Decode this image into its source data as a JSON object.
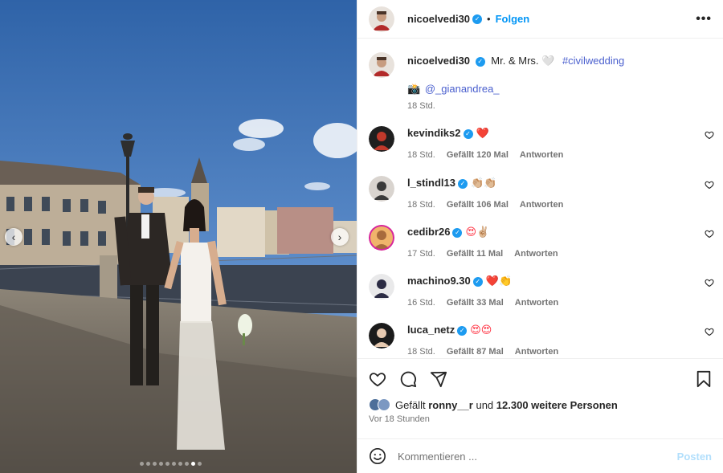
{
  "post": {
    "image_alt": "Wedding couple walking on a bridge in Zurich",
    "carousel": {
      "total": 10,
      "active_index": 8
    },
    "nav_prev": "‹",
    "nav_next": "›"
  },
  "header": {
    "username": "nicoelvedi30",
    "separator": "•",
    "follow_label": "Folgen",
    "more_label": "•••"
  },
  "caption": {
    "username": "nicoelvedi30",
    "text": "Mr. & Mrs. 🤍",
    "hashtag": "#civilwedding",
    "credit_icon": "📸",
    "mention": "@_gianandrea_",
    "time": "18 Std."
  },
  "comments": [
    {
      "username": "kevindiks2",
      "text": "❤️",
      "time": "18 Std.",
      "likes": "Gefällt 120 Mal",
      "reply": "Antworten"
    },
    {
      "username": "l_stindl13",
      "text": "👏🏼👏🏼",
      "time": "18 Std.",
      "likes": "Gefällt 106 Mal",
      "reply": "Antworten"
    },
    {
      "username": "cedibr26",
      "text": "😍✌🏼",
      "time": "17 Std.",
      "likes": "Gefällt 11 Mal",
      "reply": "Antworten"
    },
    {
      "username": "machino9.30",
      "text": "❤️👏",
      "time": "16 Std.",
      "likes": "Gefällt 33 Mal",
      "reply": "Antworten"
    },
    {
      "username": "luca_netz",
      "text": "😍😍",
      "time": "18 Std.",
      "likes": "Gefällt 87 Mal",
      "reply": "Antworten"
    }
  ],
  "likes_summary": {
    "prefix": "Gefällt",
    "first_user": "ronny__r",
    "joiner": "und",
    "others": "12.300 weitere Personen"
  },
  "posted_ago": "Vor 18 Stunden",
  "composer": {
    "placeholder": "Kommentieren ...",
    "post_label": "Posten"
  },
  "colors": {
    "link_blue": "#0095f6",
    "verified_blue": "#1d9bf0",
    "muted": "#737373"
  }
}
